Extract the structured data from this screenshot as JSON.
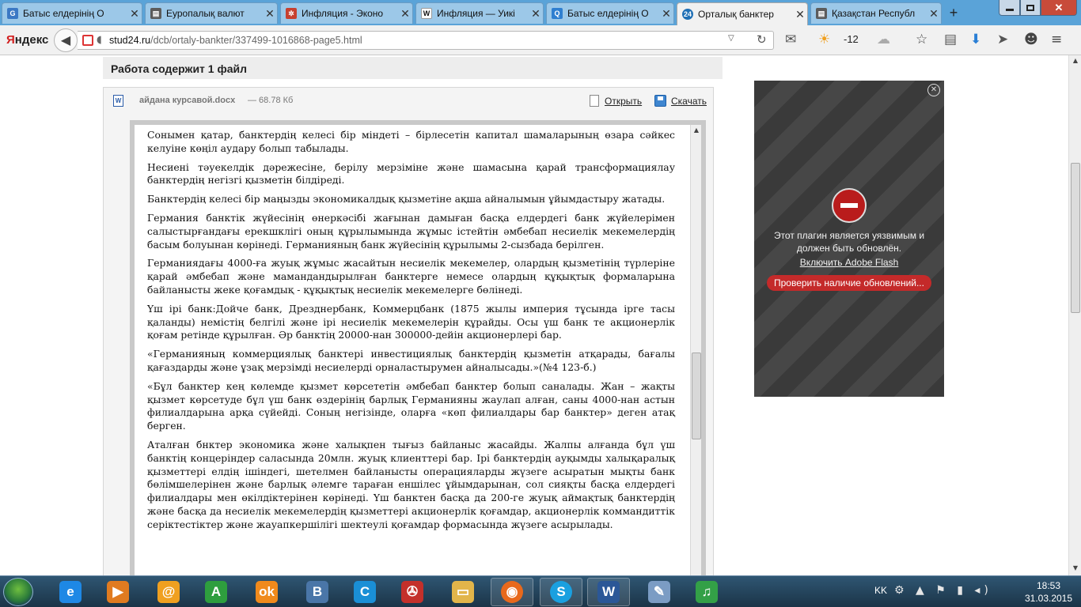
{
  "browser": {
    "tabs": [
      {
        "label": "Батыс елдерінің О",
        "icon": "vk-icon",
        "color": "#3b78c4",
        "glyph": "G",
        "active": false
      },
      {
        "label": "Еуропалық валют",
        "icon": "page-icon",
        "color": "#5c5c5c",
        "glyph": "▤",
        "active": false
      },
      {
        "label": "Инфляция - Эконо",
        "icon": "pinwheel-icon",
        "color": "#c7402f",
        "glyph": "✲",
        "active": false
      },
      {
        "label": "Инфляция — Уикі",
        "icon": "wikipedia-icon",
        "color": "#ffffff",
        "glyph": "W",
        "active": false
      },
      {
        "label": "Батыс елдерінің О",
        "icon": "yandex-search-icon",
        "color": "#2f7fd0",
        "glyph": "Q",
        "active": false
      },
      {
        "label": "Орталық банктер",
        "icon": "stud24-icon",
        "color": "#1f6fb5",
        "glyph": "24",
        "active": true
      },
      {
        "label": "Қазақстан Республ",
        "icon": "page-icon",
        "color": "#5c5c5c",
        "glyph": "▤",
        "active": false
      }
    ],
    "new_tab": "+",
    "window_controls": {
      "minimize": "–",
      "maximize": "□",
      "close": "✕"
    },
    "yandex_logo": {
      "first": "Я",
      "rest": "ндекс"
    },
    "back": "◀",
    "url": {
      "host": "stud24.ru",
      "path": "/dcb/ortaly-bankter/337499-1016868-page5.html"
    },
    "weather_temp": "-12",
    "toolbar_icons": [
      "mail-icon",
      "weather-sun-cloud-icon",
      "cloud-icon",
      "star-icon",
      "download-icon",
      "send-icon",
      "smile-icon",
      "menu-icon"
    ]
  },
  "page": {
    "work_title": "Работа содержит 1 файл",
    "file": {
      "name": "айдана курсавой.docx",
      "size": " — 68.78 Кб",
      "open": "Открыть",
      "download": "Скачать"
    },
    "document": {
      "paragraphs": [
        "Сонымен қатар, банктердің келесі бір міндеті  – бірлесетін капитал шамаларының  өзара сәйкес келуіне көңіл аудару болып табылады.",
        "Несиені тәуекелдік дәрежесіне, берілу мерзіміне  және шамасына қарай трансформациялау банктердің негізгі қызметін білдіреді.",
        "Банктердің  келесі бір маңызды экономикалдық  қызметіне ақша айналымын ұйымдастыру  жатады.",
        "Германия   банктік  жүйесінің  өнеркәсібі  жағынан   дамыған  басқа  елдердегі  банк жүйелерімен салыстырғандағы ерекшклігі оның құрылымында жұмыс істейтін әмбебап несиелік мекемелердің  басым   болуынан  көрінеді.  Германияның  банк  жүйесінің  құрылымы 2-сызбада берілген.",
        " Германиядағы  4000-ға  жуық  жұмыс  жасайтын  несиелік   мекемелер,  олардың  қызметінің  түрлеріне   қарай   әмбебап   және   мамандандырылған   банктерге   немесе олардың  құқықтық  формаларына    байланысты  жеке  қоғамдық   -  құқықтық  несиелік мекемелерге бөлінеді.",
        "Үш ірі банк:Дойче банк, Дрезднербанк, Коммерцбанк (1875 жылы империя тұсында ірге тасы қаланды) немістің белгілі және ірі несиелік мекемелерін құрайды. Осы үш банк те акционерлік қоғам ретінде құрылған. Әр банктің 20000-нан 300000-дейін акционерлері бар.",
        "«Германияның  коммерциялық банктері инвестициялық  банктердің қызметін атқарады, бағалы қағаздарды  және ұзақ мерзімді несиелерді орналастырумен айналысады.»(№4 123-б.)",
        "«Бұл  банктер кең көлемде қызмет көрсететін әмбебап банктер болып саналады. Жан – жақты қызмет көрсетуде   бұл   үш   банк   өздерінің   барлық   Германияны   жаулап   алған,   саны 4000-нан  астын  филиалдарына  арқа  сүйейді.  Соның  негізінде,  оларға  «көп  филиалдары бар банктер» деген  атақ берген.",
        "Аталған бнктер экономика және халықпен тығыз  байланыс жасайды. Жалпы алғанда  бұл үш банктің концеріндер саласында 20млн. жуық клиенттері  бар. Ірі банктердің ауқымды  халықаралық қызметтері елдің ішіндегі, шетелмен байланысты операцияларды жүзеге асыратын мықты  банк бөлімшелерінен және барлық әлемге тараған еншілес ұйымдарынан, сол  сияқты басқа елдердегі филиалдары мен өкілдіктерінен көрінеді. Үш банктен  басқа да 200-ге жуық аймақтық банктердің және басқа да несиелік мекемелердің қызметтері акционерлік қоғамдар, акционерлік  коммандиттік серіктестіктер және жауапкершілігі шектеулі қоғамдар формасында жүзеге асырылады."
      ]
    },
    "flash": {
      "close": "✕",
      "message": "Этот плагин является уязвимым и должен быть обновлён.",
      "enable": "Включить Adobe Flash",
      "check": "Проверить наличие обновлений..."
    }
  },
  "taskbar": {
    "apps": [
      {
        "name": "internet-explorer-icon",
        "glyph": "e",
        "color": "#1e88e5",
        "running": false
      },
      {
        "name": "media-player-icon",
        "glyph": "▶",
        "color": "#e07b20",
        "running": false
      },
      {
        "name": "mail-agent-icon",
        "glyph": "@",
        "color": "#f0a020",
        "running": false
      },
      {
        "name": "a-letter-app-icon",
        "glyph": "A",
        "color": "#2e9e3e",
        "running": false
      },
      {
        "name": "odnoklassniki-icon",
        "glyph": "ok",
        "color": "#f08a1c",
        "running": false
      },
      {
        "name": "vkontakte-icon",
        "glyph": "B",
        "color": "#4a76a8",
        "running": false
      },
      {
        "name": "internet-app-icon",
        "glyph": "C",
        "color": "#1a8fd6",
        "running": false
      },
      {
        "name": "steering-wheel-icon",
        "glyph": "✇",
        "color": "#c4302b",
        "running": false
      },
      {
        "name": "file-explorer-icon",
        "glyph": "▭",
        "color": "#e2b54a",
        "running": false
      },
      {
        "name": "firefox-icon",
        "glyph": "◉",
        "color": "#e8691c",
        "running": true
      },
      {
        "name": "skype-icon",
        "glyph": "S",
        "color": "#1aa0e0",
        "running": true
      },
      {
        "name": "word-icon",
        "glyph": "W",
        "color": "#2b5797",
        "running": true
      },
      {
        "name": "paint-icon",
        "glyph": "✎",
        "color": "#7b9cc4",
        "running": false
      },
      {
        "name": "music-player-icon",
        "glyph": "♫",
        "color": "#33a047",
        "running": false
      }
    ],
    "lang": "KK",
    "tray_icons": "⚙ ▲ ⚑ ▮ ◂)",
    "time": "18:53",
    "date": "31.03.2015"
  }
}
